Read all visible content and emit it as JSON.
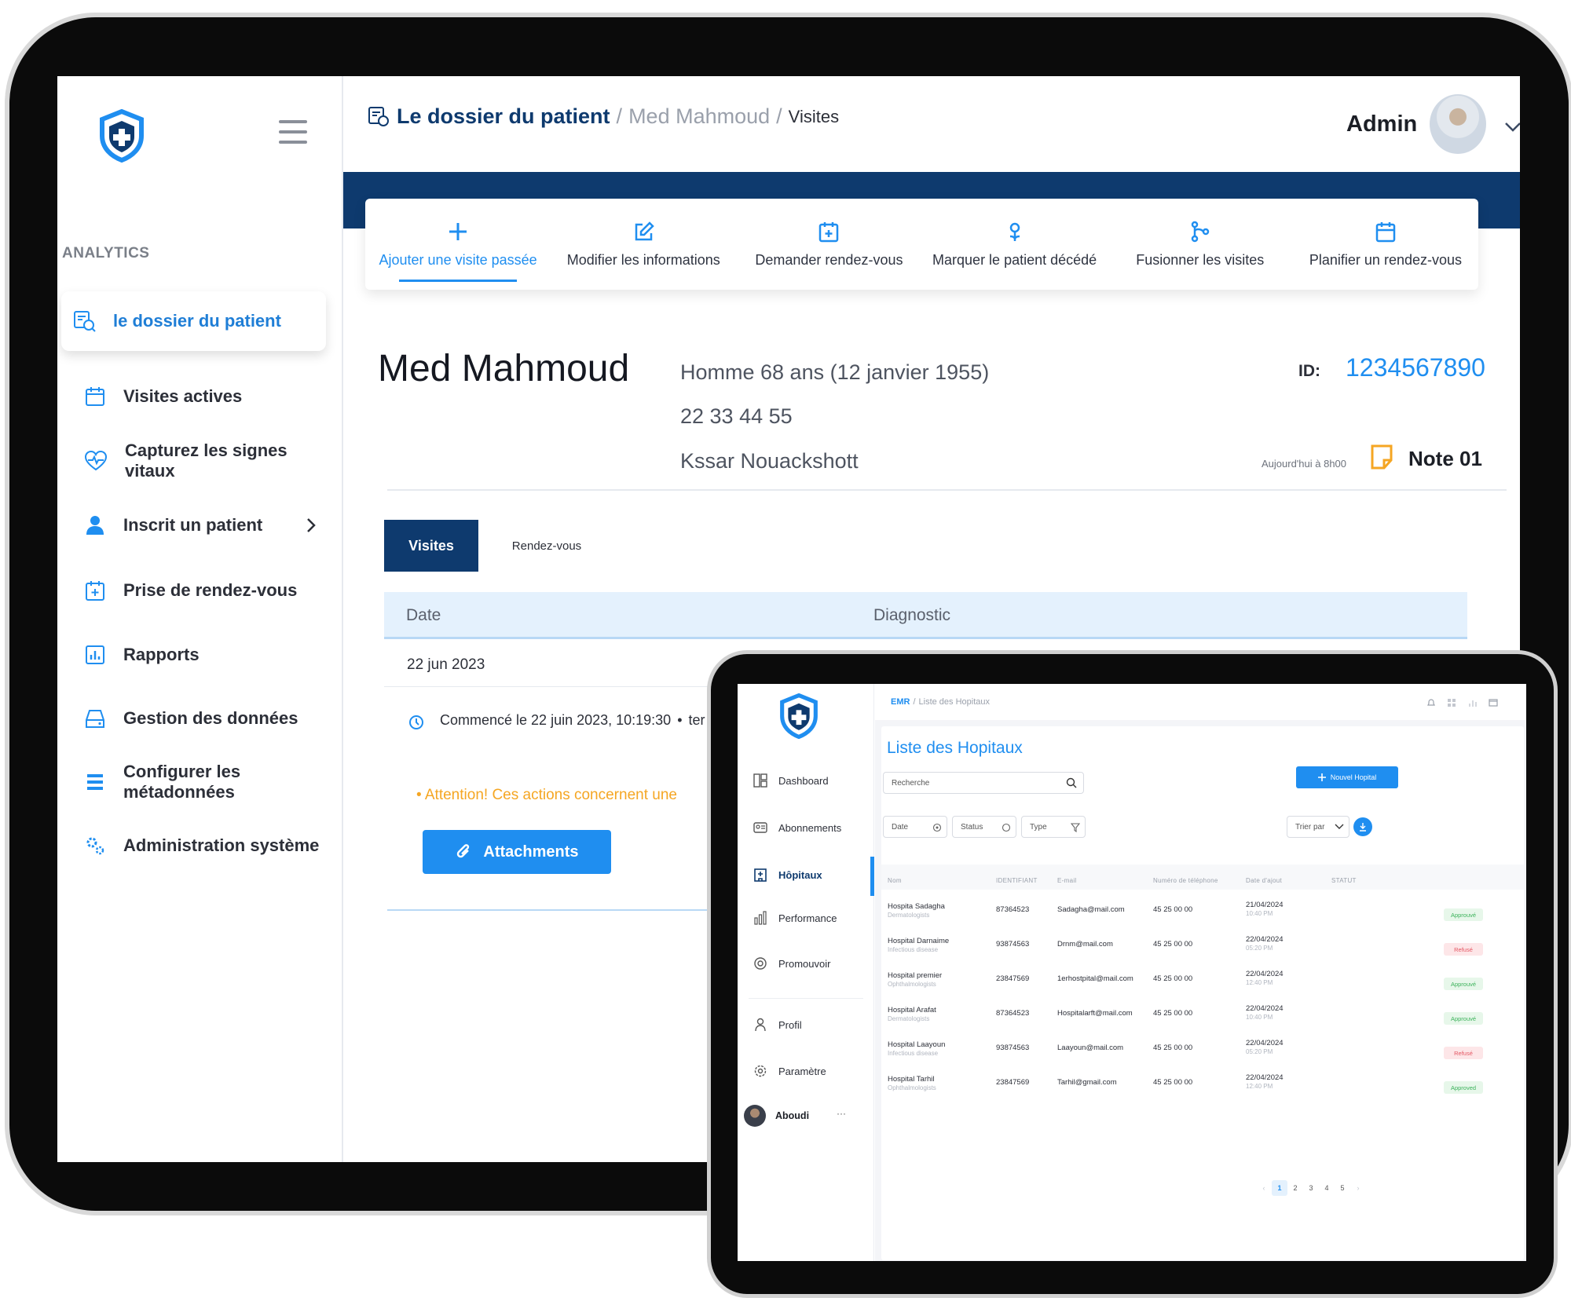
{
  "emr": {
    "sidebar": {
      "section_label": "ANALYTICS",
      "items": [
        {
          "label": "le dossier du patient",
          "icon": "patient-file-icon"
        },
        {
          "label": "Visites actives",
          "icon": "calendar-icon"
        },
        {
          "label": "Capturez les signes vitaux",
          "icon": "heart-pulse-icon"
        },
        {
          "label": "Inscrit un patient",
          "icon": "user-icon"
        },
        {
          "label": "Prise de rendez-vous",
          "icon": "calendar-plus-icon"
        },
        {
          "label": "Rapports",
          "icon": "report-icon"
        },
        {
          "label": "Gestion des données",
          "icon": "drive-icon"
        },
        {
          "label": "Configurer les métadonnées",
          "icon": "list-icon"
        },
        {
          "label": "Administration système",
          "icon": "gears-icon"
        }
      ]
    },
    "breadcrumb": {
      "root": "Le dossier du patient",
      "sep": "/",
      "patient": "Med Mahmoud",
      "current": "Visites"
    },
    "user": {
      "name": "Admin"
    },
    "actions": [
      {
        "label": "Ajouter une visite passée",
        "icon": "plus-icon"
      },
      {
        "label": "Modifier les informations",
        "icon": "edit-icon"
      },
      {
        "label": "Demander rendez-vous",
        "icon": "calendar-plus-icon"
      },
      {
        "label": "Marquer le patient décédé",
        "icon": "flower-icon"
      },
      {
        "label": "Fusionner les visites",
        "icon": "merge-icon"
      },
      {
        "label": "Planifier un rendez-vous",
        "icon": "calendar-icon"
      }
    ],
    "patient": {
      "name": "Med Mahmoud",
      "demographics": "Homme 68 ans (12 janvier 1955)",
      "phone": "22 33 44 55",
      "address": "Kssar Nouackshott",
      "id_label": "ID:",
      "id_value": "1234567890",
      "note_time": "Aujourd'hui à 8h00",
      "note_label": "Note 01"
    },
    "tabs": {
      "visits": "Visites",
      "appointments": "Rendez-vous"
    },
    "table": {
      "headers": {
        "date": "Date",
        "diagnostic": "Diagnostic"
      },
      "row_date": "22 jun 2023",
      "started": "Commencé le 22 juin 2023, 10:19:30",
      "bullet": "•",
      "started_cont": "ter",
      "warning": "• Attention! Ces actions concernent une",
      "attach_label": "Attachments"
    }
  },
  "hosp": {
    "breadcrumb": {
      "root": "EMR",
      "sep": "/",
      "current": "Liste des Hopitaux"
    },
    "sidebar": {
      "items": [
        {
          "label": "Dashboard",
          "icon": "dashboard-icon"
        },
        {
          "label": "Abonnements",
          "icon": "id-card-icon"
        },
        {
          "label": "Hôpitaux",
          "icon": "hospital-icon"
        },
        {
          "label": "Performance",
          "icon": "bar-chart-icon"
        },
        {
          "label": "Promouvoir",
          "icon": "target-icon"
        },
        {
          "label": "Profil",
          "icon": "person-icon"
        },
        {
          "label": "Paramètre",
          "icon": "settings-icon"
        }
      ],
      "user": "Aboudi",
      "more": "···"
    },
    "title": "Liste des Hopitaux",
    "search_placeholder": "Recherche",
    "new_button": "Nouvel Hopital",
    "filters": {
      "date": "Date",
      "status": "Status",
      "type": "Type",
      "sort": "Trier par"
    },
    "columns": [
      "Nom",
      "IDENTIFIANT",
      "E-mail",
      "Numéro de téléphone",
      "Date d'ajout",
      "STATUT"
    ],
    "rows": [
      {
        "name": "Hospita Sadagha",
        "spec": "Dermatologists",
        "id": "87364523",
        "email": "Sadagha@mail.com",
        "phone": "45 25 00 00",
        "date": "21/04/2024",
        "time": "10:40 PM",
        "status": "Approuvé",
        "ok": true
      },
      {
        "name": "Hospital Darnaime",
        "spec": "Infectious disease",
        "id": "93874563",
        "email": "Drnm@mail.com",
        "phone": "45 25 00 00",
        "date": "22/04/2024",
        "time": "05:20 PM",
        "status": "Refusé",
        "ok": false
      },
      {
        "name": "Hospital premier",
        "spec": "Ophthalmologists",
        "id": "23847569",
        "email": "1erhostpital@mail.com",
        "phone": "45 25 00 00",
        "date": "22/04/2024",
        "time": "12:40 PM",
        "status": "Approuvé",
        "ok": true
      },
      {
        "name": "Hospital Arafat",
        "spec": "Dermatologists",
        "id": "87364523",
        "email": "Hospitalarft@mail.com",
        "phone": "45 25 00 00",
        "date": "22/04/2024",
        "time": "10:40 PM",
        "status": "Approuvé",
        "ok": true
      },
      {
        "name": "Hospital Laayoun",
        "spec": "Infectious disease",
        "id": "93874563",
        "email": "Laayoun@mail.com",
        "phone": "45 25 00 00",
        "date": "22/04/2024",
        "time": "05:20 PM",
        "status": "Refusé",
        "ok": false
      },
      {
        "name": "Hospital Tarhil",
        "spec": "Ophthalmologists",
        "id": "23847569",
        "email": "Tarhil@gmail.com",
        "phone": "45 25 00 00",
        "date": "22/04/2024",
        "time": "12:40 PM",
        "status": "Approved",
        "ok": true
      }
    ],
    "pages": [
      "1",
      "2",
      "3",
      "4",
      "5"
    ],
    "page_prev": "‹",
    "page_next": "›",
    "colors": {
      "accent": "#1f8ef0",
      "navy": "#0e3a6e",
      "approved": "#3bb25a",
      "refused": "#e45763"
    }
  }
}
